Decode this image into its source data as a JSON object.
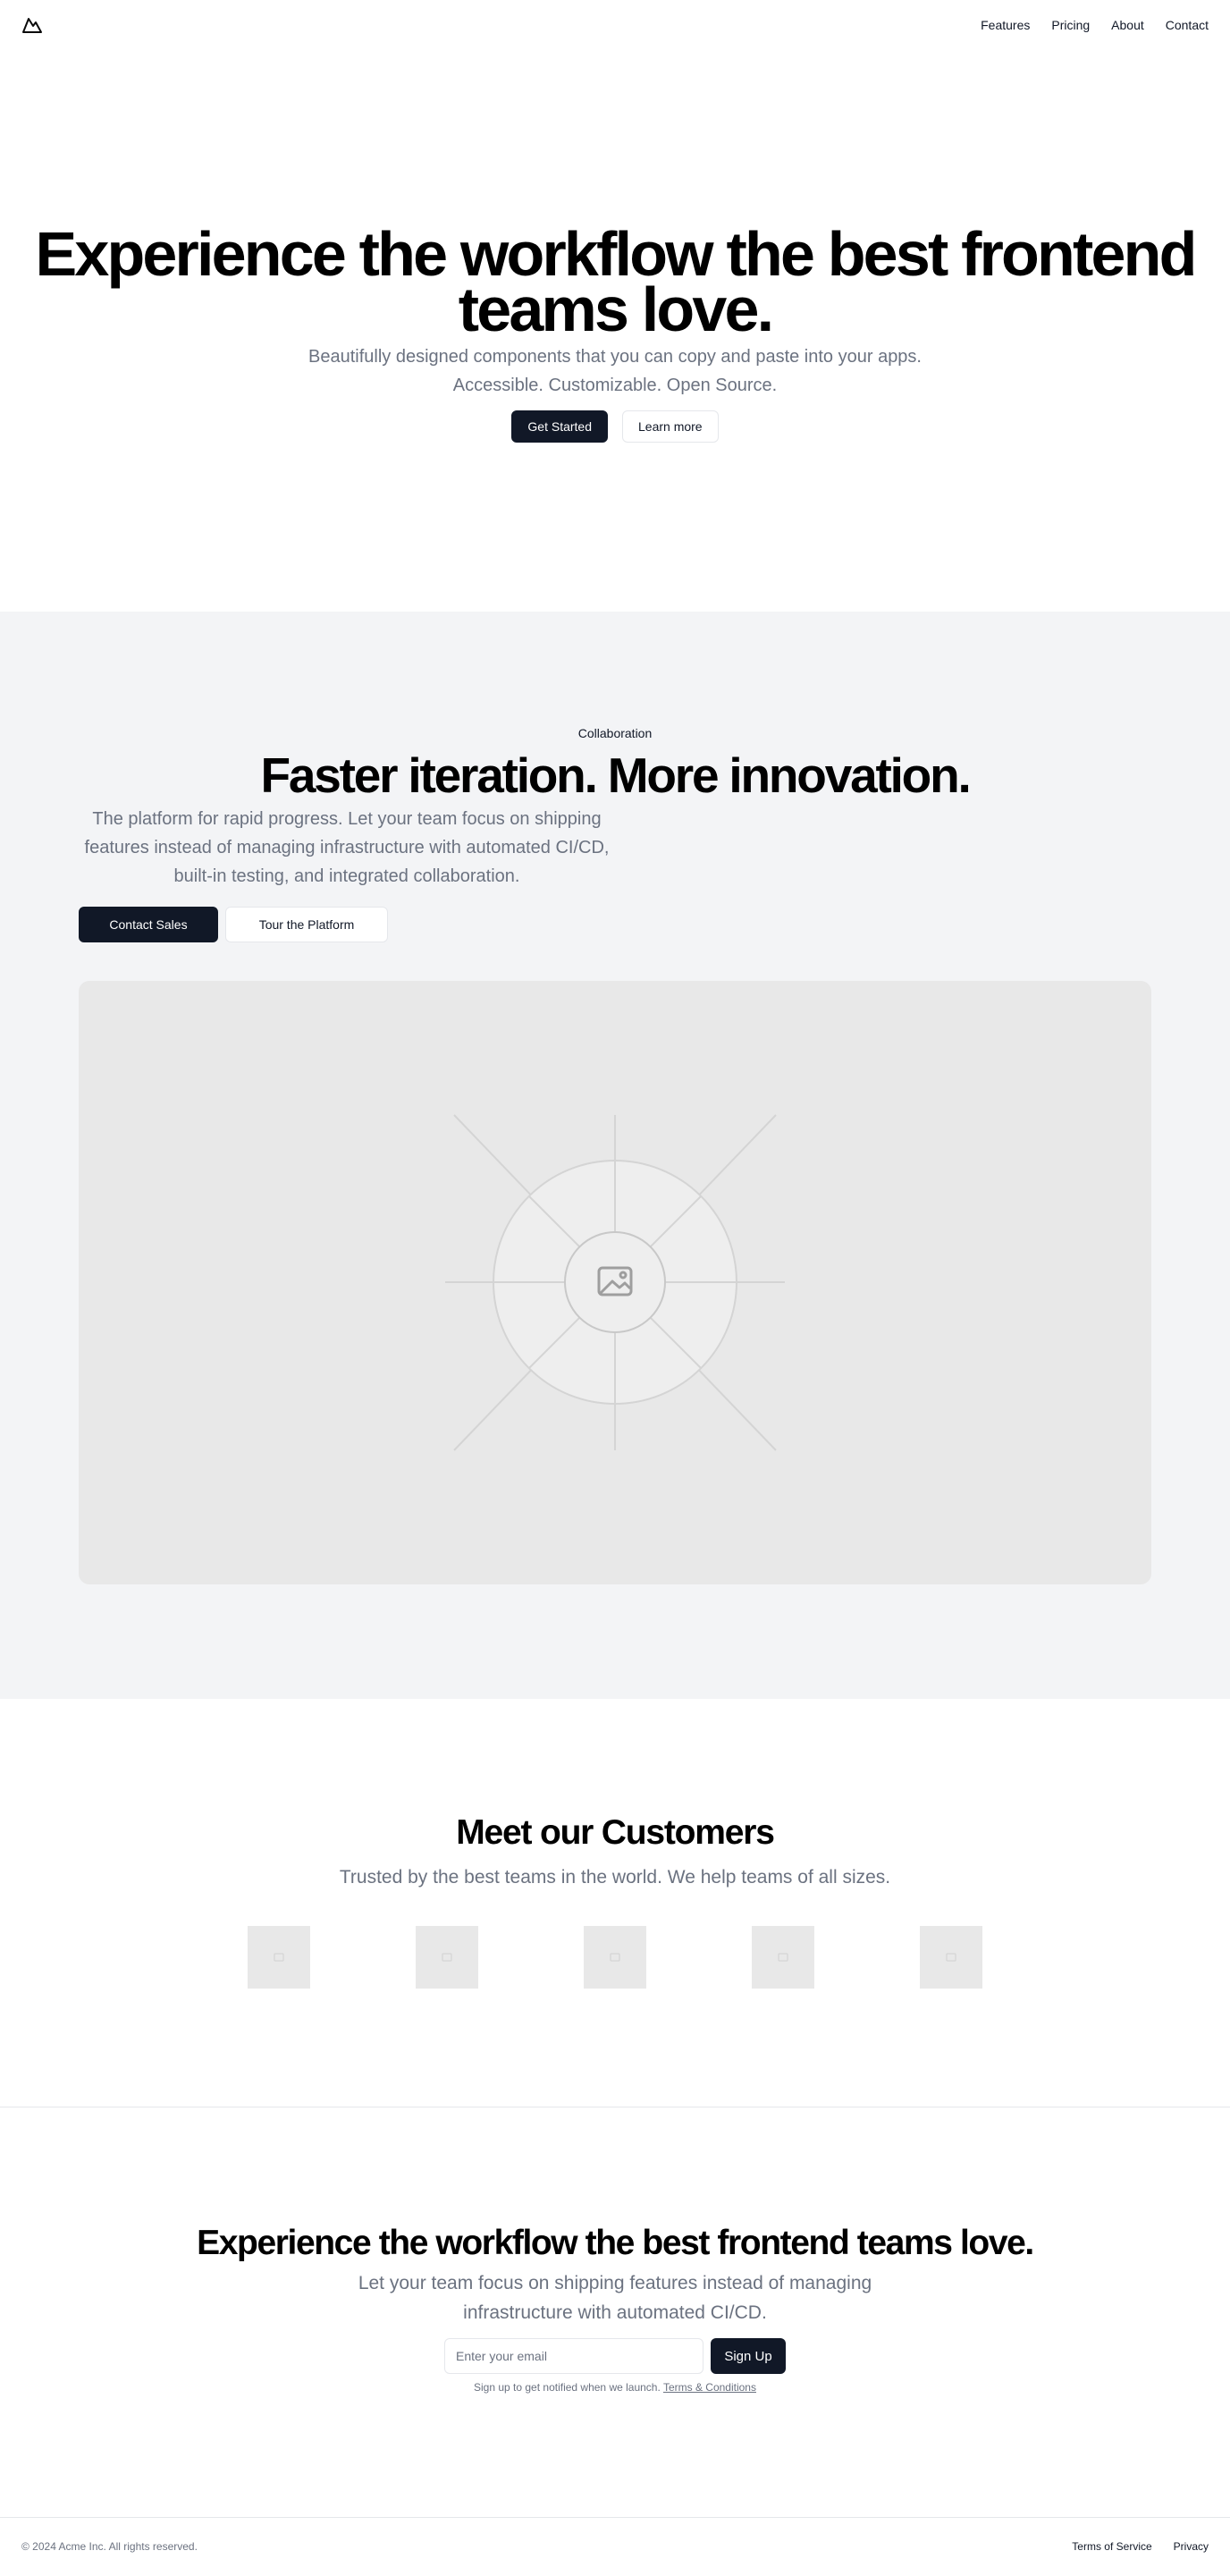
{
  "header": {
    "logo_icon": "mountain-icon",
    "nav": [
      "Features",
      "Pricing",
      "About",
      "Contact"
    ]
  },
  "hero": {
    "title": "Experience the workflow the best frontend teams love.",
    "subtitle": "Beautifully designed components that you can copy and paste into your apps. Accessible. Customizable. Open Source.",
    "primary_button": "Get Started",
    "secondary_button": "Learn more"
  },
  "collaboration": {
    "eyebrow": "Collaboration",
    "title": "Faster iteration. More innovation.",
    "description": "The platform for rapid progress. Let your team focus on shipping features instead of managing infrastructure with automated CI/CD, built-in testing, and integrated collaboration.",
    "primary_button": "Contact Sales",
    "secondary_button": "Tour the Platform",
    "image_icon": "image-placeholder-icon"
  },
  "customers": {
    "title": "Meet our Customers",
    "subtitle": "Trusted by the best teams in the world. We help teams of all sizes.",
    "logo_icons": [
      "customer-logo-icon",
      "customer-logo-icon",
      "customer-logo-icon",
      "customer-logo-icon",
      "customer-logo-icon"
    ]
  },
  "signup": {
    "title": "Experience the workflow the best frontend teams love.",
    "description": "Let your team focus on shipping features instead of managing infrastructure with automated CI/CD.",
    "email_placeholder": "Enter your email",
    "button": "Sign Up",
    "note": "Sign up to get notified when we launch.",
    "terms_link": "Terms & Conditions"
  },
  "footer": {
    "copyright": "© 2024 Acme Inc. All rights reserved.",
    "links": [
      "Terms of Service",
      "Privacy"
    ]
  },
  "colors": {
    "primary": "#111827",
    "muted_text": "#6b7280",
    "section_bg": "#f3f4f6",
    "placeholder_bg": "#e8e8e8"
  }
}
